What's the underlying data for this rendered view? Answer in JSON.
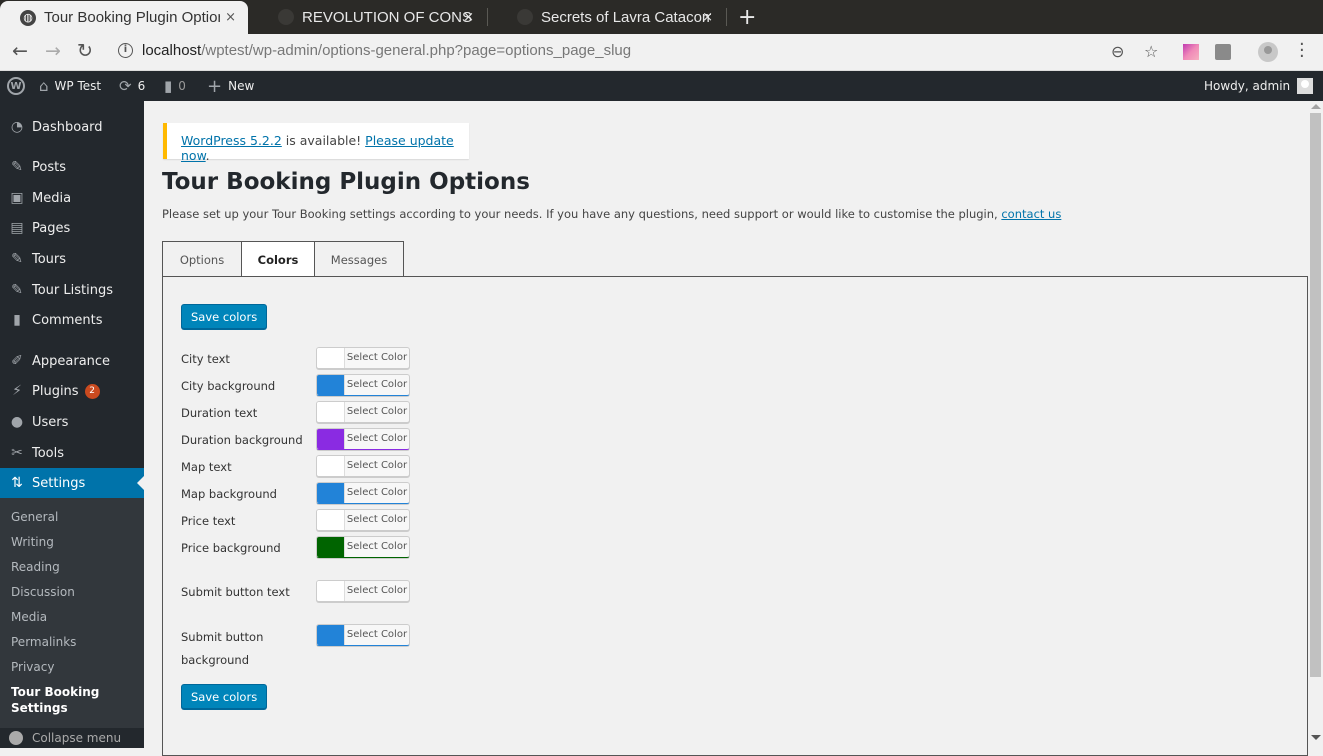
{
  "browser": {
    "tabs": [
      {
        "title": "Tour Booking Plugin Options",
        "active": true
      },
      {
        "title": "REVOLUTION OF CONSCIOUSNESS",
        "active": false
      },
      {
        "title": "Secrets of Lavra Catacombs",
        "active": false
      }
    ],
    "close_glyph": "×",
    "new_tab_glyph": "+",
    "url_host": "localhost",
    "url_path": "/wptest/wp-admin/options-general.php?page=options_page_slug",
    "icons": {
      "back": "←",
      "forward": "→",
      "reload": "↻",
      "info": "i",
      "zoom": "⊖",
      "star": "☆",
      "menu": "⋮"
    }
  },
  "adminbar": {
    "site_name": "WP Test",
    "updates_count": "6",
    "comments_count": "0",
    "new_label": "New",
    "howdy": "Howdy, admin",
    "icons": {
      "wp": "W",
      "home": "⌂",
      "updates": "⟳",
      "comments": "▮",
      "new": "+"
    }
  },
  "sidebar": {
    "items": [
      {
        "label": "Dashboard",
        "icon": "◔"
      },
      {
        "label": "Posts",
        "icon": "✎"
      },
      {
        "label": "Media",
        "icon": "▣"
      },
      {
        "label": "Pages",
        "icon": "▤"
      },
      {
        "label": "Tours",
        "icon": "✎"
      },
      {
        "label": "Tour Listings",
        "icon": "✎"
      },
      {
        "label": "Comments",
        "icon": "▮"
      },
      {
        "label": "Appearance",
        "icon": "✐"
      },
      {
        "label": "Plugins",
        "icon": "⚡",
        "badge": "2"
      },
      {
        "label": "Users",
        "icon": "●"
      },
      {
        "label": "Tools",
        "icon": "✂"
      },
      {
        "label": "Settings",
        "icon": "⇅",
        "current": true
      }
    ],
    "submenu": [
      "General",
      "Writing",
      "Reading",
      "Discussion",
      "Media",
      "Permalinks",
      "Privacy"
    ],
    "submenu_current_line1": "Tour Booking",
    "submenu_current_line2": "Settings",
    "collapse_label": "Collapse menu"
  },
  "notice": {
    "link1": "WordPress 5.2.2",
    "middle": " is available! ",
    "link2": "Please update now",
    "end": ".",
    "accent": "#ffb900"
  },
  "page": {
    "title": "Tour Booking Plugin Options",
    "intro": "Please set up your Tour Booking settings according to your needs. If you have any questions, need support or would like to customise the plugin, ",
    "contact_link": "contact us",
    "tabs": [
      {
        "label": "Options",
        "active": false
      },
      {
        "label": "Colors",
        "active": true
      },
      {
        "label": "Messages",
        "active": false
      }
    ],
    "save_label": "Save colors",
    "select_color_label": "Select Color",
    "fields": [
      {
        "label": "City text",
        "color": "#ffffff"
      },
      {
        "label": "City background",
        "color": "#2283d8"
      },
      {
        "label": "Duration text",
        "color": "#ffffff"
      },
      {
        "label": "Duration background",
        "color": "#8a2be2"
      },
      {
        "label": "Map text",
        "color": "#ffffff"
      },
      {
        "label": "Map background",
        "color": "#2283d8"
      },
      {
        "label": "Price text",
        "color": "#ffffff"
      },
      {
        "label": "Price background",
        "color": "#006400"
      },
      {
        "label": "Submit button text",
        "color": "#ffffff"
      },
      {
        "label_line1": "Submit button",
        "label_line2": "background",
        "color": "#2283d8"
      }
    ]
  }
}
